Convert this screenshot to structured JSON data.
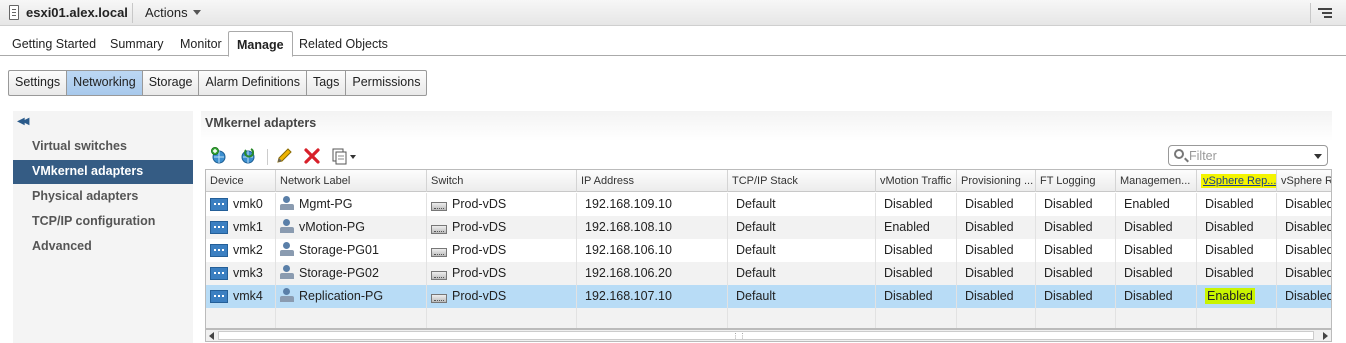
{
  "header": {
    "host_name": "esxi01.alex.local",
    "actions_label": "Actions"
  },
  "main_tabs": [
    {
      "label": "Getting Started",
      "active": false
    },
    {
      "label": "Summary",
      "active": false
    },
    {
      "label": "Monitor",
      "active": false
    },
    {
      "label": "Manage",
      "active": true
    },
    {
      "label": "Related Objects",
      "active": false
    }
  ],
  "sub_tabs": [
    {
      "label": "Settings",
      "active": false
    },
    {
      "label": "Networking",
      "active": true
    },
    {
      "label": "Storage",
      "active": false
    },
    {
      "label": "Alarm Definitions",
      "active": false
    },
    {
      "label": "Tags",
      "active": false
    },
    {
      "label": "Permissions",
      "active": false
    }
  ],
  "sidebar": {
    "items": [
      {
        "label": "Virtual switches",
        "active": false
      },
      {
        "label": "VMkernel adapters",
        "active": true
      },
      {
        "label": "Physical adapters",
        "active": false
      },
      {
        "label": "TCP/IP configuration",
        "active": false
      },
      {
        "label": "Advanced",
        "active": false
      }
    ]
  },
  "panel": {
    "title": "VMkernel adapters",
    "filter_placeholder": "Filter",
    "toolbar_icons": [
      "add-host-networking-icon",
      "refresh-icon",
      "edit-icon",
      "remove-icon",
      "more-actions-icon"
    ]
  },
  "table": {
    "columns": [
      "Device",
      "Network Label",
      "Switch",
      "IP Address",
      "TCP/IP Stack",
      "vMotion Traffic",
      "Provisioning ...",
      "FT Logging",
      "Managemen...",
      "vSphere Rep...",
      "vSphere Re"
    ],
    "highlighted_column": 9,
    "rows": [
      {
        "device": "vmk0",
        "label": "Mgmt-PG",
        "switch": "Prod-vDS",
        "ip": "192.168.109.10",
        "stack": "Default",
        "vmotion": "Disabled",
        "provisioning": "Disabled",
        "ft": "Disabled",
        "mgmt": "Enabled",
        "vrep": "Disabled",
        "vrep2": "Disabled",
        "selected": false
      },
      {
        "device": "vmk1",
        "label": "vMotion-PG",
        "switch": "Prod-vDS",
        "ip": "192.168.108.10",
        "stack": "Default",
        "vmotion": "Enabled",
        "provisioning": "Disabled",
        "ft": "Disabled",
        "mgmt": "Disabled",
        "vrep": "Disabled",
        "vrep2": "Disabled",
        "selected": false
      },
      {
        "device": "vmk2",
        "label": "Storage-PG01",
        "switch": "Prod-vDS",
        "ip": "192.168.106.10",
        "stack": "Default",
        "vmotion": "Disabled",
        "provisioning": "Disabled",
        "ft": "Disabled",
        "mgmt": "Disabled",
        "vrep": "Disabled",
        "vrep2": "Disabled",
        "selected": false
      },
      {
        "device": "vmk3",
        "label": "Storage-PG02",
        "switch": "Prod-vDS",
        "ip": "192.168.106.20",
        "stack": "Default",
        "vmotion": "Disabled",
        "provisioning": "Disabled",
        "ft": "Disabled",
        "mgmt": "Disabled",
        "vrep": "Disabled",
        "vrep2": "Disabled",
        "selected": false
      },
      {
        "device": "vmk4",
        "label": "Replication-PG",
        "switch": "Prod-vDS",
        "ip": "192.168.107.10",
        "stack": "Default",
        "vmotion": "Disabled",
        "provisioning": "Disabled",
        "ft": "Disabled",
        "mgmt": "Disabled",
        "vrep": "Enabled",
        "vrep2": "Disabled",
        "selected": true
      }
    ]
  },
  "colors": {
    "nav_active_bg": "#355c84",
    "subtab_active_bg": "#bcd7f3",
    "row_selected_bg": "#b8dcf6",
    "highlight_yellow": "#f4f400",
    "highlight_green": "#c9f400"
  }
}
